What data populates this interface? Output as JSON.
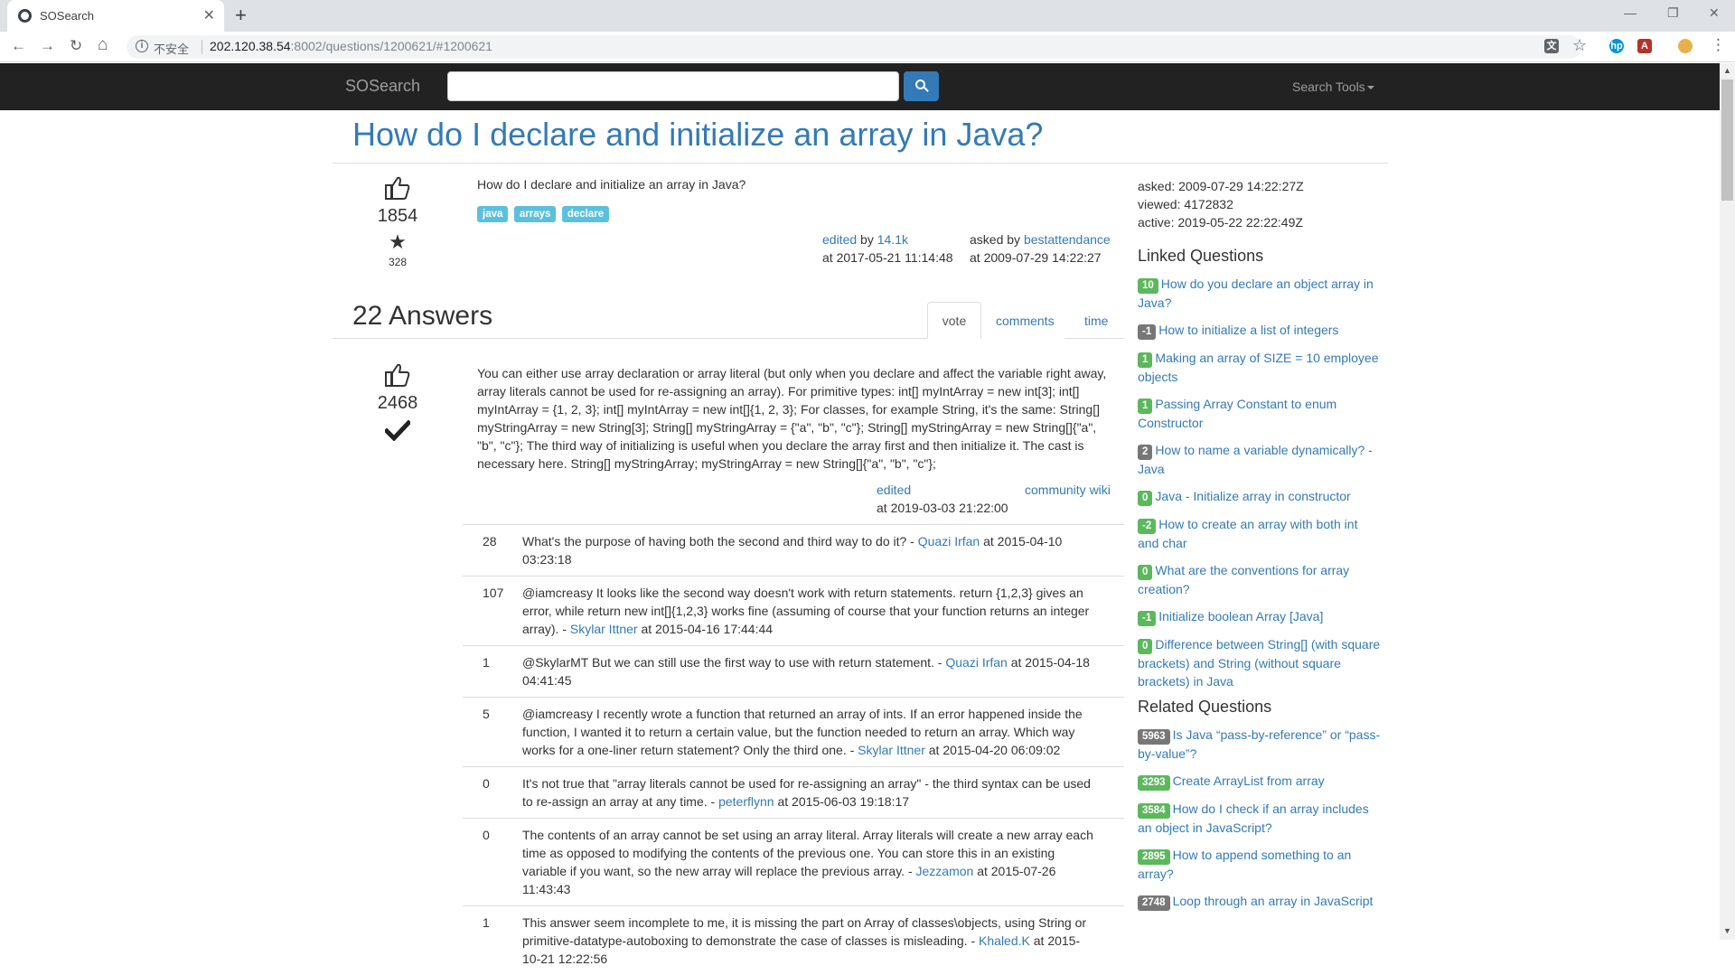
{
  "browser": {
    "tab_title": "SOSearch",
    "tab_close": "✕",
    "new_tab": "+",
    "insecure_label": "不安全",
    "url_host": "202.120.38.54",
    "url_rest": ":8002/questions/1200621/#1200621",
    "minimize": "—",
    "maximize": "❐",
    "close": "✕",
    "back": "←",
    "forward": "→",
    "reload": "↻",
    "home": "⌂",
    "star": "☆",
    "menu": "⋮"
  },
  "navbar": {
    "brand": "SOSearch",
    "search_placeholder": "",
    "tools_label": "Search Tools"
  },
  "question": {
    "title": "How do I declare and initialize an array in Java?",
    "body": "How do I declare and initialize an array in Java?",
    "votes": "1854",
    "favorites": "328",
    "tags": [
      "java",
      "arrays",
      "declare"
    ],
    "edited_label": "edited",
    "edited_by_prefix": "by",
    "edited_by": "14.1k",
    "edited_at": "at 2017-05-21 11:14:48",
    "asked_label": "asked by",
    "asked_by": "bestattendance",
    "asked_at": "at 2009-07-29 14:22:27"
  },
  "answers_header": "22 Answers",
  "sort_tabs": {
    "vote": "vote",
    "comments": "comments",
    "time": "time"
  },
  "answer": {
    "votes": "2468",
    "body": "You can either use array declaration or array literal (but only when you declare and affect the variable right away, array literals cannot be used for re-assigning an array). For primitive types: int[] myIntArray = new int[3]; int[] myIntArray = {1, 2, 3}; int[] myIntArray = new int[]{1, 2, 3}; For classes, for example String, it's the same: String[] myStringArray = new String[3]; String[] myStringArray = {\"a\", \"b\", \"c\"}; String[] myStringArray = new String[]{\"a\", \"b\", \"c\"}; The third way of initializing is useful when you declare the array first and then initialize it. The cast is necessary here. String[] myStringArray; myStringArray = new String[]{\"a\", \"b\", \"c\"};",
    "edited_label": "edited",
    "edited_at": "at 2019-03-03 21:22:00",
    "owner": "community wiki"
  },
  "comments": [
    {
      "score": "28",
      "text": "What's the purpose of having both the second and third way to do it? -",
      "user": "Quazi Irfan",
      "at": "at 2015-04-10 03:23:18"
    },
    {
      "score": "107",
      "text": "@iamcreasy It looks like the second way doesn't work with return statements. return {1,2,3} gives an error, while return new int[]{1,2,3} works fine (assuming of course that your function returns an integer array). -",
      "user": "Skylar Ittner",
      "at": "at 2015-04-16 17:44:44"
    },
    {
      "score": "1",
      "text": "@SkylarMT But we can still use the first way to use with return statement. -",
      "user": "Quazi Irfan",
      "at": "at 2015-04-18 04:41:45"
    },
    {
      "score": "5",
      "text": "@iamcreasy I recently wrote a function that returned an array of ints. If an error happened inside the function, I wanted it to return a certain value, but the function needed to return an array. Which way works for a one-liner return statement? Only the third one. -",
      "user": "Skylar Ittner",
      "at": "at 2015-04-20 06:09:02"
    },
    {
      "score": "0",
      "text": "It's not true that \"array literals cannot be used for re-assigning an array\" - the third syntax can be used to re-assign an array at any time. -",
      "user": "peterflynn",
      "at": "at 2015-06-03 19:18:17"
    },
    {
      "score": "0",
      "text": "The contents of an array cannot be set using an array literal. Array literals will create a new array each time as opposed to modifying the contents of the previous one. You can store this in an existing variable if you want, so the new array will replace the previous array. -",
      "user": "Jezzamon",
      "at": "at 2015-07-26 11:43:43"
    },
    {
      "score": "1",
      "text": "This answer seem incomplete to me, it is missing the part on Array of classes\\objects, using String or primitive-datatype-autoboxing to demonstrate the case of classes is misleading. -",
      "user": "Khaled.K",
      "at": "at 2015-10-21 12:22:56"
    }
  ],
  "sidebar": {
    "asked": "asked: 2009-07-29 14:22:27Z",
    "viewed": "viewed: 4172832",
    "active": "active: 2019-05-22 22:22:49Z",
    "linked_title": "Linked Questions",
    "linked": [
      {
        "score": "10",
        "color": "#5cb85c",
        "title": "How do you declare an object array in Java?"
      },
      {
        "score": "-1",
        "color": "#777777",
        "title": "How to initialize a list of integers"
      },
      {
        "score": "1",
        "color": "#5cb85c",
        "title": "Making an array of SIZE = 10 employee objects"
      },
      {
        "score": "1",
        "color": "#5cb85c",
        "title": "Passing Array Constant to enum Constructor"
      },
      {
        "score": "2",
        "color": "#777777",
        "title": "How to name a variable dynamically? - Java"
      },
      {
        "score": "0",
        "color": "#5cb85c",
        "title": "Java - Initialize array in constructor"
      },
      {
        "score": "-2",
        "color": "#5cb85c",
        "title": "How to create an array with both int and char"
      },
      {
        "score": "0",
        "color": "#5cb85c",
        "title": "What are the conventions for array creation?"
      },
      {
        "score": "-1",
        "color": "#5cb85c",
        "title": "Initialize boolean Array [Java]"
      },
      {
        "score": "0",
        "color": "#5cb85c",
        "title": "Difference between String[] (with square brackets) and String (without square brackets) in Java"
      }
    ],
    "related_title": "Related Questions",
    "related": [
      {
        "score": "5963",
        "color": "#777777",
        "title": "Is Java “pass-by-reference” or “pass-by-value”?"
      },
      {
        "score": "3293",
        "color": "#5cb85c",
        "title": "Create ArrayList from array"
      },
      {
        "score": "3584",
        "color": "#5cb85c",
        "title": "How do I check if an array includes an object in JavaScript?"
      },
      {
        "score": "2895",
        "color": "#5cb85c",
        "title": "How to append something to an array?"
      },
      {
        "score": "2748",
        "color": "#777777",
        "title": "Loop through an array in JavaScript"
      }
    ]
  }
}
